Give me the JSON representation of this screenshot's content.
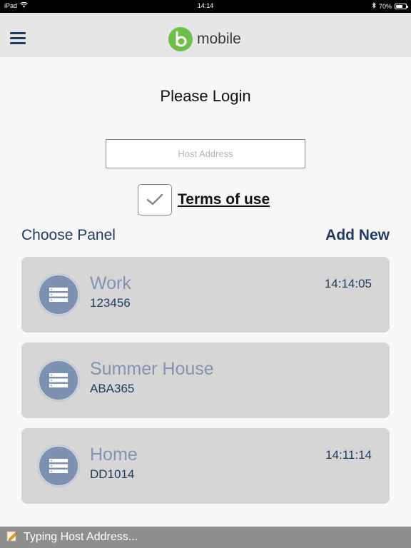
{
  "status_bar": {
    "device": "iPad",
    "time": "14:14",
    "battery": "70%",
    "battery_level": 0.7,
    "icons": [
      "wifi-icon",
      "bluetooth-icon",
      "battery-icon"
    ]
  },
  "nav": {
    "menu_icon": "hamburger-icon",
    "logo_text": "mobile",
    "logo_color": "#6dbf4a"
  },
  "login": {
    "title": "Please Login",
    "host_placeholder": "Host Address",
    "host_value": "",
    "terms_checked": true,
    "terms_label": "Terms of use"
  },
  "panels_section": {
    "heading": "Choose Panel",
    "add_new": "Add New",
    "panels": [
      {
        "name": "Work",
        "code": "123456",
        "time": "14:14:05"
      },
      {
        "name": "Summer House",
        "code": "ABA365",
        "time": ""
      },
      {
        "name": "Home",
        "code": "DD1014",
        "time": "14:11:14"
      }
    ]
  },
  "bottom_bar": {
    "text": "Typing Host Address...",
    "icon": "note-pencil-icon"
  },
  "colors": {
    "accent": "#1e3a5f",
    "card_bg": "#d6d6d6",
    "panel_icon": "#7c92b0"
  }
}
